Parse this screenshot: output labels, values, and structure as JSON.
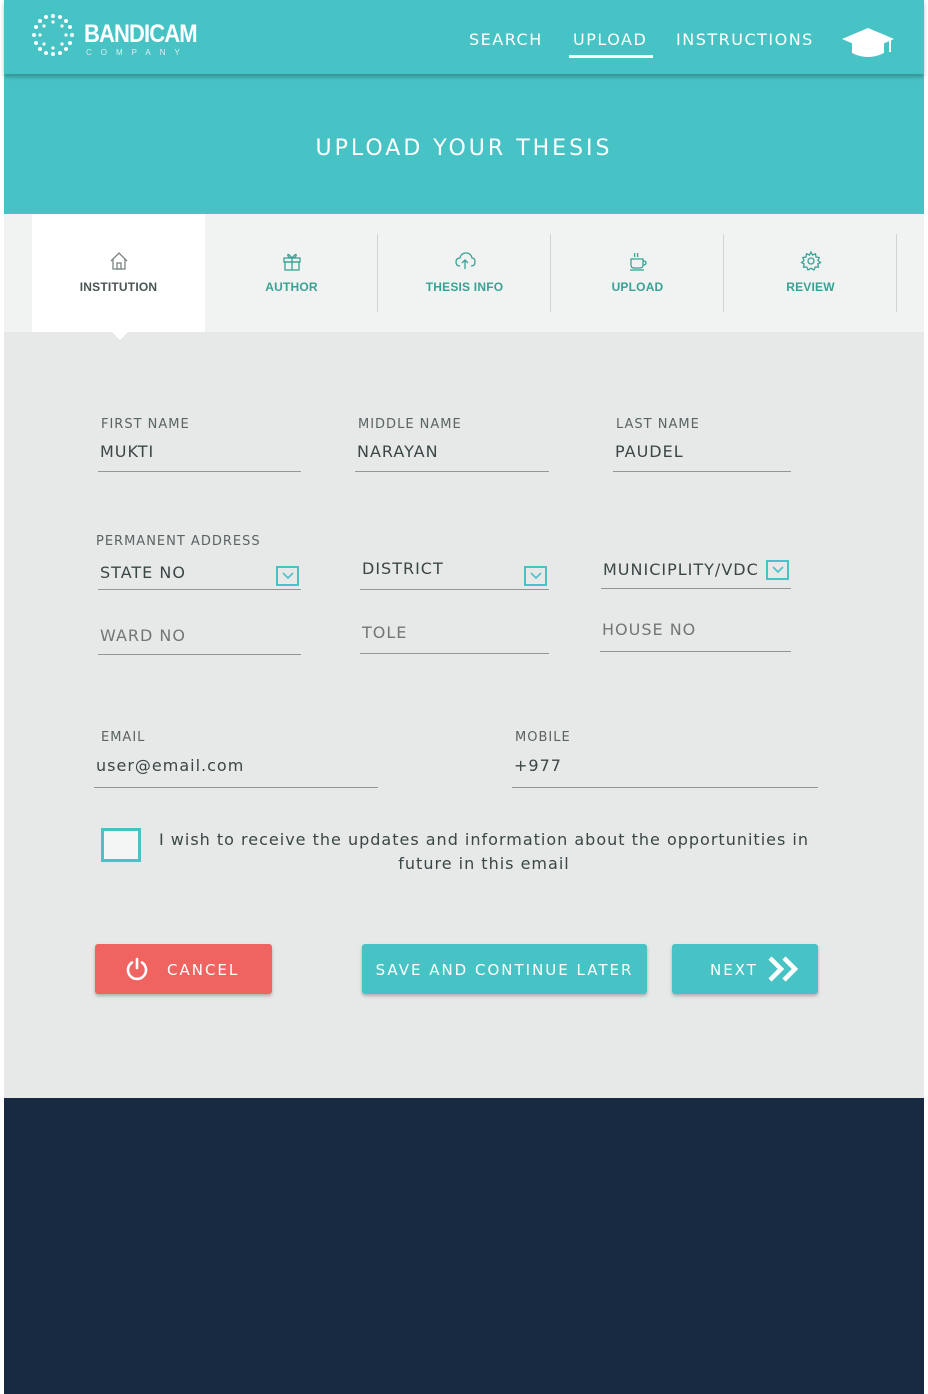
{
  "header": {
    "logo_text": "BANDICAM",
    "logo_sub": "COMPANY",
    "nav": [
      {
        "label": "SEARCH"
      },
      {
        "label": "UPLOAD"
      },
      {
        "label": "INSTRUCTIONS"
      }
    ],
    "active_nav": "UPLOAD",
    "icon": "graduation-cap-icon"
  },
  "banner": {
    "title": "UPLOAD YOUR THESIS"
  },
  "tabs": [
    {
      "label": "INSTITUTION",
      "icon": "home-icon"
    },
    {
      "label": "AUTHOR",
      "icon": "gift-icon"
    },
    {
      "label": "THESIS INFO",
      "icon": "cloud-upload-icon"
    },
    {
      "label": "UPLOAD",
      "icon": "coffee-cup-icon"
    },
    {
      "label": "REVIEW",
      "icon": "gear-icon"
    }
  ],
  "active_tab": "INSTITUTION",
  "form": {
    "first_name": {
      "label": "FIRST NAME",
      "value": "MUKTI"
    },
    "middle_name": {
      "label": "MIDDLE NAME",
      "value": "NARAYAN"
    },
    "last_name": {
      "label": "LAST NAME",
      "value": "PAUDEL"
    },
    "address_label": "PERMANENT ADDRESS",
    "state": "STATE NO",
    "district": "DISTRICT",
    "municipality": "MUNICIPLITY/VDC",
    "ward_placeholder": "WARD NO",
    "tole_placeholder": "TOLE",
    "house_placeholder": "HOUSE NO",
    "email": {
      "label": "EMAIL",
      "value": "user@email.com"
    },
    "mobile": {
      "label": "MOBILE",
      "value": "+977"
    },
    "consent": "I wish to receive the updates and information about the opportunities in future in this email"
  },
  "buttons": {
    "cancel": "CANCEL",
    "save": "SAVE AND CONTINUE LATER",
    "next": "NEXT"
  },
  "colors": {
    "accent": "#48c3c5",
    "cancel": "#ef6461",
    "footer": "#172a41",
    "tab_label": "#3aa294"
  }
}
